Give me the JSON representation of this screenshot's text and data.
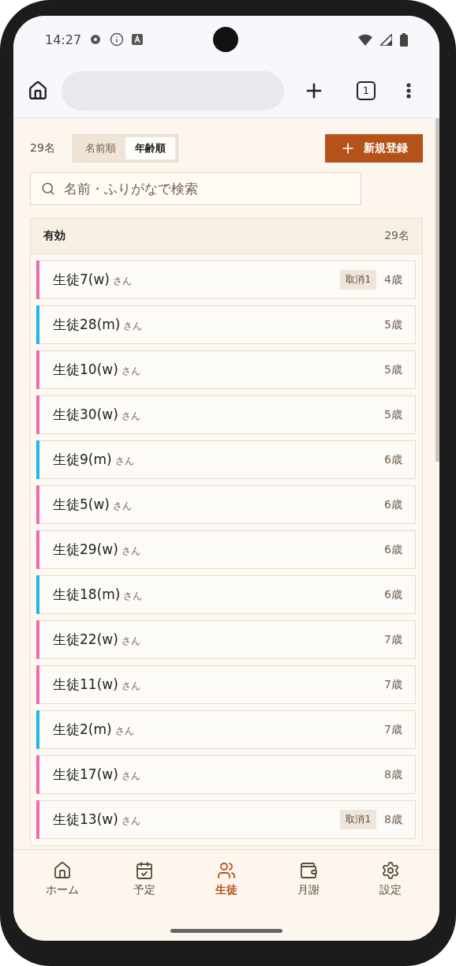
{
  "status_bar": {
    "time": "14:27"
  },
  "browser_toolbar": {
    "tab_count": "1"
  },
  "header": {
    "count": "29名",
    "sort_tabs": [
      {
        "label": "名前順",
        "selected": false
      },
      {
        "label": "年齢順",
        "selected": true
      }
    ],
    "new_button": "新規登録"
  },
  "search": {
    "placeholder": "名前・ふりがなで検索"
  },
  "section": {
    "title": "有効",
    "count": "29名"
  },
  "students": [
    {
      "name": "生徒7(w)",
      "suffix": "さん",
      "tag": "取消1",
      "age": "4歳",
      "color": "#f06ab0"
    },
    {
      "name": "生徒28(m)",
      "suffix": "さん",
      "age": "5歳",
      "color": "#1cb8ec"
    },
    {
      "name": "生徒10(w)",
      "suffix": "さん",
      "age": "5歳",
      "color": "#f06ab0"
    },
    {
      "name": "生徒30(w)",
      "suffix": "さん",
      "age": "5歳",
      "color": "#f06ab0"
    },
    {
      "name": "生徒9(m)",
      "suffix": "さん",
      "age": "6歳",
      "color": "#1cb8ec"
    },
    {
      "name": "生徒5(w)",
      "suffix": "さん",
      "age": "6歳",
      "color": "#f06ab0"
    },
    {
      "name": "生徒29(w)",
      "suffix": "さん",
      "age": "6歳",
      "color": "#f06ab0"
    },
    {
      "name": "生徒18(m)",
      "suffix": "さん",
      "age": "6歳",
      "color": "#1cb8ec"
    },
    {
      "name": "生徒22(w)",
      "suffix": "さん",
      "age": "7歳",
      "color": "#f06ab0"
    },
    {
      "name": "生徒11(w)",
      "suffix": "さん",
      "age": "7歳",
      "color": "#f06ab0"
    },
    {
      "name": "生徒2(m)",
      "suffix": "さん",
      "age": "7歳",
      "color": "#1cb8ec"
    },
    {
      "name": "生徒17(w)",
      "suffix": "さん",
      "age": "8歳",
      "color": "#f06ab0"
    },
    {
      "name": "生徒13(w)",
      "suffix": "さん",
      "tag": "取消1",
      "age": "8歳",
      "color": "#f06ab0"
    }
  ],
  "bottom_nav": [
    {
      "kind": "home",
      "label": "ホーム",
      "selected": false
    },
    {
      "kind": "schedule",
      "label": "予定",
      "selected": false
    },
    {
      "kind": "students",
      "label": "生徒",
      "selected": true
    },
    {
      "kind": "fees",
      "label": "月謝",
      "selected": false
    },
    {
      "kind": "settings",
      "label": "設定",
      "selected": false
    }
  ]
}
